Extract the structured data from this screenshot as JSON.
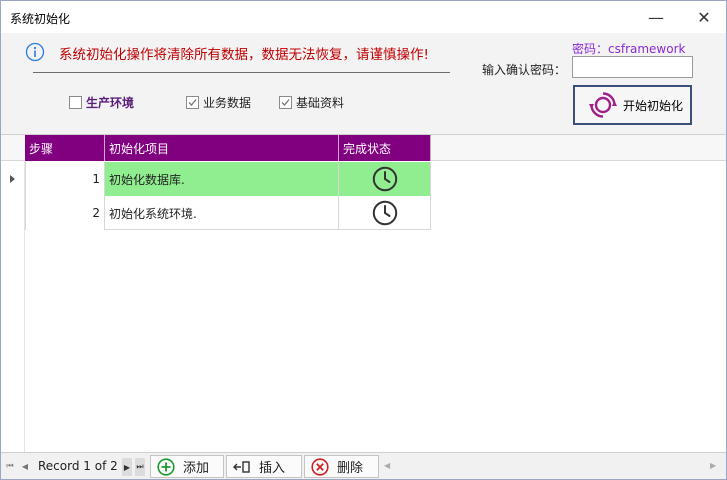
{
  "window": {
    "title": "系统初始化",
    "minimize_glyph": "—",
    "close_glyph": "✕"
  },
  "warning": {
    "text": "系统初始化操作将清除所有数据，数据无法恢复，请谨慎操作!",
    "icon": "info-icon",
    "color": "#c00000"
  },
  "options": {
    "production": {
      "label": "生产环境",
      "checked": false
    },
    "business": {
      "label": "业务数据",
      "checked": true
    },
    "base": {
      "label": "基础资料",
      "checked": true
    }
  },
  "password": {
    "hint": "密码：csframework",
    "label": "输入确认密码：",
    "value": ""
  },
  "start_button": {
    "label": "开始初始化",
    "icon": "refresh-ring-icon",
    "icon_color": "#a0208c"
  },
  "grid": {
    "columns": [
      "步骤",
      "初始化项目",
      "完成状态"
    ],
    "header_color": "#800080",
    "rows": [
      {
        "step": "1",
        "item": "初始化数据库.",
        "status": "pending-clock-icon",
        "active": true
      },
      {
        "step": "2",
        "item": "初始化系统环境.",
        "status": "pending-clock-icon",
        "active": false
      }
    ],
    "active_row_color": "#90ee90"
  },
  "navigator": {
    "record_text": "Record 1 of 2",
    "buttons": {
      "add": "添加",
      "insert": "插入",
      "delete": "删除"
    }
  }
}
